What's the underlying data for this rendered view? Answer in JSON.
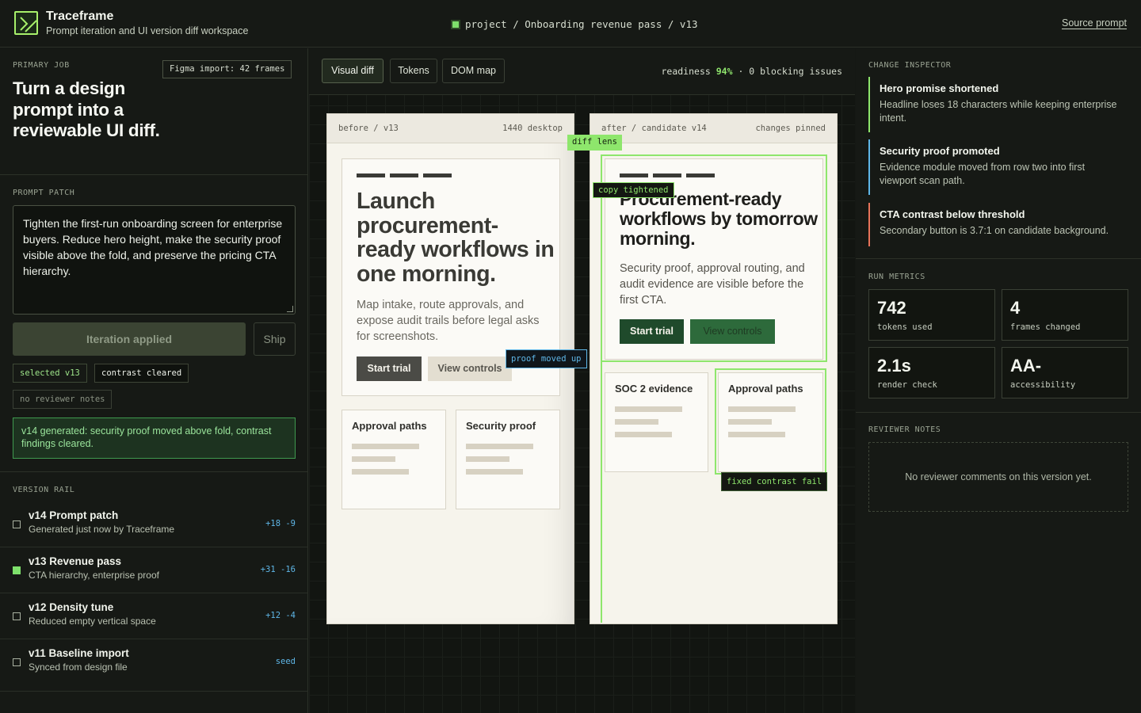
{
  "app": {
    "name": "Traceframe",
    "subtitle": "Prompt iteration and UI version diff workspace"
  },
  "breadcrumb": "project / Onboarding revenue pass / v13",
  "source_prompt": "Source prompt",
  "left": {
    "primary_job_label": "PRIMARY JOB",
    "figma_badge": "Figma import: 42 frames",
    "primary_job_title": "Turn a design prompt into a reviewable UI diff.",
    "prompt_patch_label": "PROMPT PATCH",
    "prompt_text": "Tighten the first-run onboarding screen for enterprise buyers. Reduce hero height, make the security proof visible above the fold, and preserve the pricing CTA hierarchy.",
    "applied_button": "Iteration applied",
    "ship_button": "Ship",
    "chips": {
      "selected": "selected v13",
      "contrast": "contrast cleared",
      "notes": "no reviewer notes"
    },
    "generated_msg": "v14 generated: security proof moved above fold, contrast findings cleared.",
    "version_rail_label": "VERSION RAIL",
    "versions": [
      {
        "title": "v14 Prompt patch",
        "sub": "Generated just now by Traceframe",
        "delta": "+18 -9"
      },
      {
        "title": "v13 Revenue pass",
        "sub": "CTA hierarchy, enterprise proof",
        "delta": "+31 -16"
      },
      {
        "title": "v12 Density tune",
        "sub": "Reduced empty vertical space",
        "delta": "+12 -4"
      },
      {
        "title": "v11 Baseline import",
        "sub": "Synced from design file",
        "delta": "seed"
      }
    ]
  },
  "center": {
    "tabs": [
      "Visual diff",
      "Tokens",
      "DOM map"
    ],
    "readiness_prefix": "readiness ",
    "readiness_value": "94%",
    "readiness_suffix": " · 0 blocking issues",
    "before": {
      "label": "before / v13",
      "size": "1440 desktop",
      "headline": "Launch procurement-ready workflows in one morning.",
      "body": "Map intake, route approvals, and expose audit trails before legal asks for screenshots.",
      "primary": "Start trial",
      "secondary": "View controls",
      "card1": "Approval paths",
      "card2": "Security proof"
    },
    "after": {
      "label": "after / candidate v14",
      "status": "changes pinned",
      "headline": "Procurement-ready workflows by tomorrow morning.",
      "body": "Security proof, approval routing, and audit evidence are visible before the first CTA.",
      "primary": "Start trial",
      "secondary": "View controls",
      "card1": "SOC 2 evidence",
      "card2": "Approval paths"
    },
    "annotations": {
      "lens": "diff lens",
      "copy": "copy tightened",
      "proof": "proof moved up",
      "contrast": "fixed contrast fail"
    }
  },
  "right": {
    "inspector_label": "CHANGE INSPECTOR",
    "changes": [
      {
        "title": "Hero promise shortened",
        "desc": "Headline loses 18 characters while keeping enterprise intent.",
        "color": "#8ee66c"
      },
      {
        "title": "Security proof promoted",
        "desc": "Evidence module moved from row two into first viewport scan path.",
        "color": "#5fb7e8"
      },
      {
        "title": "CTA contrast below threshold",
        "desc": "Secondary button is 3.7:1 on candidate background.",
        "color": "#e8735a"
      }
    ],
    "metrics_label": "RUN METRICS",
    "metrics": [
      {
        "value": "742",
        "label": "tokens used"
      },
      {
        "value": "4",
        "label": "frames changed"
      },
      {
        "value": "2.1s",
        "label": "render check"
      },
      {
        "value": "AA-",
        "label": "accessibility"
      }
    ],
    "notes_label": "REVIEWER NOTES",
    "notes_empty": "No reviewer comments on this version yet."
  }
}
